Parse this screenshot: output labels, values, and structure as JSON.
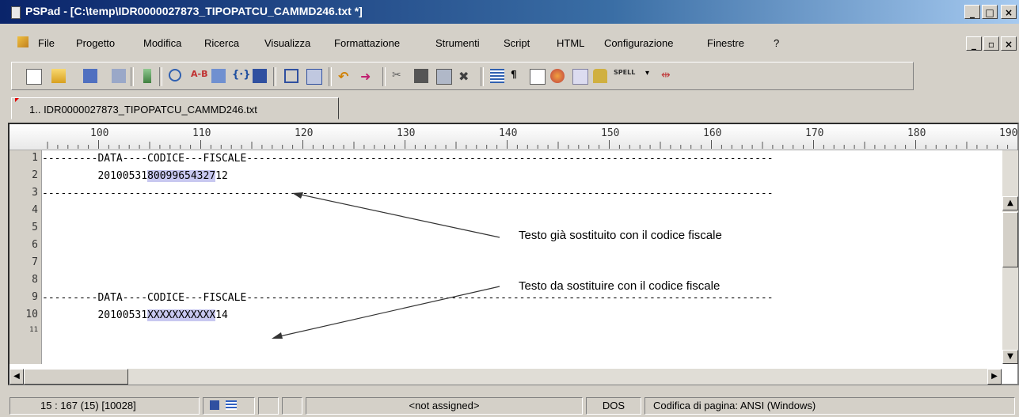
{
  "window": {
    "title": "PSPad - [C:\\temp\\IDR0000027873_TIPOPATCU_CAMMD246.txt *]",
    "controls": {
      "minimize": "_",
      "maximize": "□",
      "close": "×"
    }
  },
  "menubar": {
    "items": [
      "File",
      "Progetto",
      "Modifica",
      "Ricerca",
      "Visualizza",
      "Formattazione",
      "Strumenti",
      "Script",
      "HTML",
      "Configurazione",
      "Finestre",
      "?"
    ],
    "doc_controls": {
      "minimize": "_",
      "restore": "▫",
      "close": "×"
    }
  },
  "toolbar": {
    "buttons": [
      "new-file-icon",
      "open-file-icon",
      "save-icon",
      "save-all-icon",
      "project-tree-icon",
      "find-icon",
      "replace-icon",
      "insert-text-icon",
      "code-icon",
      "compare-icon",
      "preview-icon",
      "print-icon",
      "undo-icon",
      "redo-icon",
      "cut-icon",
      "copy-icon",
      "paste-icon",
      "delete-icon",
      "wrap-icon",
      "pilcrow-icon",
      "column-icon",
      "color-icon",
      "block-icon",
      "lock-icon",
      "spell-icon",
      "pin-icon"
    ],
    "spell_label": "SPELL"
  },
  "tabs": [
    {
      "label": "1.. IDR0000027873_TIPOPATCU_CAMMD246.txt"
    }
  ],
  "ruler": {
    "labels": [
      "100",
      "110",
      "120",
      "130",
      "140",
      "150",
      "160",
      "170",
      "180",
      "190"
    ]
  },
  "editor": {
    "lines": [
      {
        "num": "1",
        "pre": "---------DATA----CODICE---FISCALE-------------------------------------------------------------------------------------",
        "sel": "",
        "post": ""
      },
      {
        "num": "2",
        "pre": "         20100531",
        "sel": "80099654327",
        "post": "12"
      },
      {
        "num": "3",
        "pre": "----------------------------------------------------------------------------------------------------------------------",
        "sel": "",
        "post": ""
      },
      {
        "num": "4",
        "pre": "",
        "sel": "",
        "post": ""
      },
      {
        "num": "5",
        "pre": "",
        "sel": "",
        "post": ""
      },
      {
        "num": "6",
        "pre": "",
        "sel": "",
        "post": ""
      },
      {
        "num": "7",
        "pre": "",
        "sel": "",
        "post": ""
      },
      {
        "num": "8",
        "pre": "",
        "sel": "",
        "post": ""
      },
      {
        "num": "9",
        "pre": "---------DATA----CODICE---FISCALE-------------------------------------------------------------------------------------",
        "sel": "",
        "post": ""
      },
      {
        "num": "10",
        "pre": "         20100531",
        "sel": "XXXXXXXXXXX",
        "post": "14"
      },
      {
        "num": "11",
        "pre": "",
        "sel": "",
        "post": ""
      }
    ]
  },
  "annotations": [
    {
      "text": "Testo già sostituito con il codice fiscale"
    },
    {
      "text": "Testo da sostituire con il codice fiscale"
    }
  ],
  "statusbar": {
    "position": "15 : 167  (15)  [10028]",
    "highlighter": "<not assigned>",
    "line_end": "DOS",
    "encoding": "Codifica di pagina: ANSI (Windows)"
  }
}
